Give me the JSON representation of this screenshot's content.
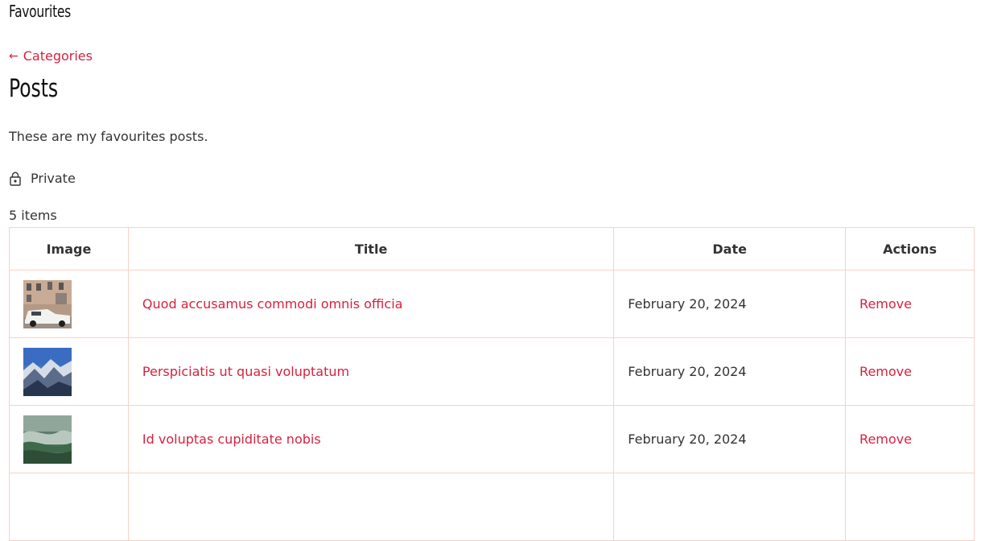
{
  "site": {
    "title": "Favourites"
  },
  "nav": {
    "back_arrow": "←",
    "back_label": "Categories"
  },
  "page": {
    "heading": "Posts",
    "description": "These are my favourites posts.",
    "privacy_label": "Private",
    "privacy_icon": "lock-icon",
    "item_count": "5 items"
  },
  "colors": {
    "accent": "#d6223f",
    "border": "#f7d2c6",
    "text": "#333333"
  },
  "table": {
    "headers": [
      "Image",
      "Title",
      "Date",
      "Actions"
    ],
    "rows": [
      {
        "title": "Quod accusamus commodi omnis officia",
        "date": "February 20, 2024",
        "action": "Remove"
      },
      {
        "title": "Perspiciatis ut quasi voluptatum",
        "date": "February 20, 2024",
        "action": "Remove"
      },
      {
        "title": "Id voluptas cupiditate nobis",
        "date": "February 20, 2024",
        "action": "Remove"
      }
    ]
  }
}
